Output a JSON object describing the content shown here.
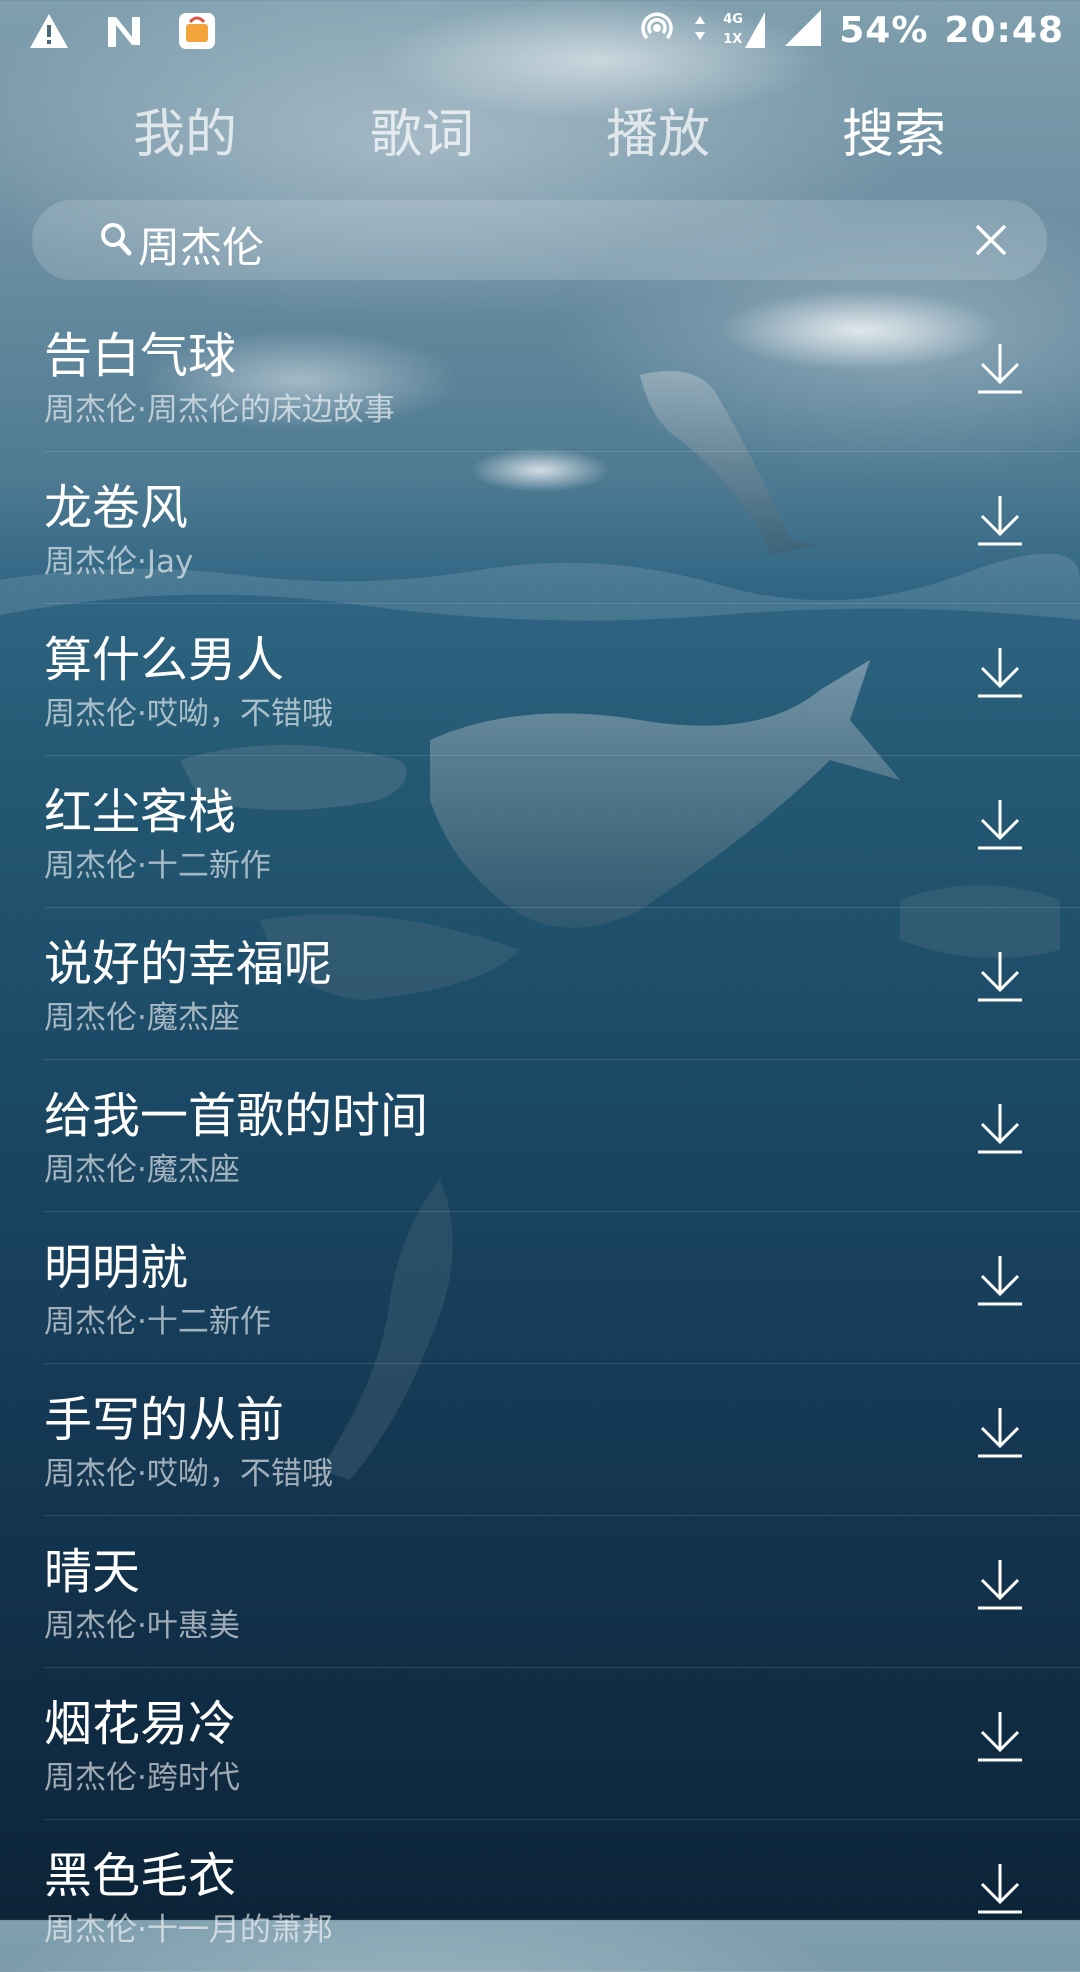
{
  "status_bar": {
    "battery": "54%",
    "time": "20:48",
    "network_top": "4G",
    "network_bottom": "1X",
    "icons": [
      "warning-icon",
      "nfc-icon",
      "app-notification-icon",
      "hotspot-icon",
      "data-arrows-icon",
      "signal-icon",
      "signal-icon"
    ]
  },
  "tabs": [
    {
      "label": "我的"
    },
    {
      "label": "歌词"
    },
    {
      "label": "播放"
    },
    {
      "label": "搜索"
    }
  ],
  "active_tab": "搜索",
  "search": {
    "query": "周杰伦"
  },
  "songs": [
    {
      "title": "告白气球",
      "subtitle": "周杰伦·周杰伦的床边故事"
    },
    {
      "title": "龙卷风",
      "subtitle": "周杰伦·Jay"
    },
    {
      "title": "算什么男人",
      "subtitle": "周杰伦·哎呦，不错哦"
    },
    {
      "title": "红尘客栈",
      "subtitle": "周杰伦·十二新作"
    },
    {
      "title": "说好的幸福呢",
      "subtitle": "周杰伦·魔杰座"
    },
    {
      "title": "给我一首歌的时间",
      "subtitle": "周杰伦·魔杰座"
    },
    {
      "title": "明明就",
      "subtitle": "周杰伦·十二新作"
    },
    {
      "title": "手写的从前",
      "subtitle": "周杰伦·哎呦，不错哦"
    },
    {
      "title": "晴天",
      "subtitle": "周杰伦·叶惠美"
    },
    {
      "title": "烟花易冷",
      "subtitle": "周杰伦·跨时代"
    },
    {
      "title": "黑色毛衣",
      "subtitle": "周杰伦·十一月的萧邦"
    }
  ],
  "colors": {
    "text": "#ffffff",
    "subtext": "rgba(255,255,255,0.6)",
    "sea_dark": "#0c2438",
    "sky": "#7f9fae"
  }
}
